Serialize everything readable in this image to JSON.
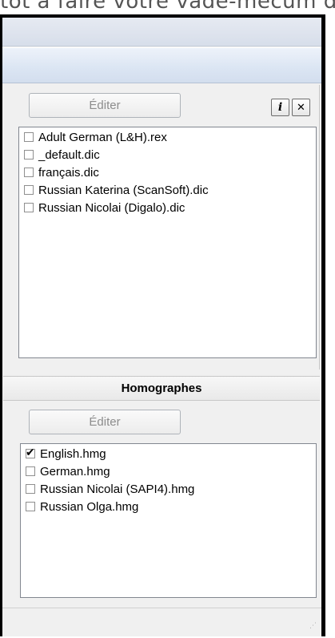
{
  "background_text": "tôt à faire votre vade-mecum de",
  "dictionaries": {
    "edit_label": "Éditer",
    "info_label": "i",
    "close_label": "✕",
    "items": [
      {
        "label": "Adult German (L&H).rex",
        "checked": false
      },
      {
        "label": "_default.dic",
        "checked": false
      },
      {
        "label": "français.dic",
        "checked": false
      },
      {
        "label": "Russian Katerina (ScanSoft).dic",
        "checked": false
      },
      {
        "label": "Russian Nicolai (Digalo).dic",
        "checked": false
      }
    ]
  },
  "homographs": {
    "title": "Homographes",
    "edit_label": "Éditer",
    "items": [
      {
        "label": "English.hmg",
        "checked": true
      },
      {
        "label": "German.hmg",
        "checked": false
      },
      {
        "label": "Russian Nicolai (SAPI4).hmg",
        "checked": false
      },
      {
        "label": "Russian Olga.hmg",
        "checked": false
      }
    ]
  },
  "icons": {
    "info": "info-icon",
    "close": "close-icon",
    "checkmark": "checkmark-icon",
    "resize_grip": "resize-grip-icon"
  }
}
